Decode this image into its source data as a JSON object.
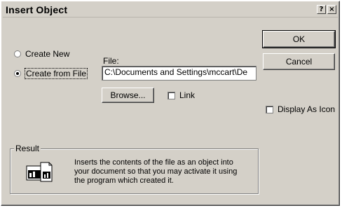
{
  "window": {
    "title": "Insert Object",
    "help_icon": "?",
    "close_icon": "×"
  },
  "options": {
    "create_new_label": "Create New",
    "create_from_file_label": "Create from File",
    "selected": "create_from_file"
  },
  "file": {
    "label": "File:",
    "value": "C:\\Documents and Settings\\mccart\\De",
    "browse_label": "Browse...",
    "link_label": "Link"
  },
  "buttons": {
    "ok": "OK",
    "cancel": "Cancel"
  },
  "display_as_icon_label": "Display As Icon",
  "result": {
    "title": "Result",
    "lines": [
      "Inserts the contents of the file as an object into",
      "your document so that you may activate it using",
      "the program which created it."
    ],
    "icon": "file-object-icon"
  }
}
